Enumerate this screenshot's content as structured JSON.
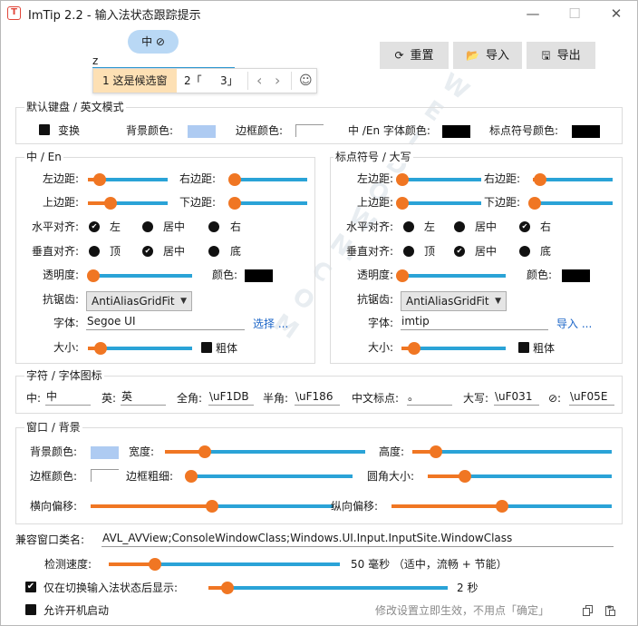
{
  "window": {
    "app_icon": "T",
    "title": "ImTip 2.2 - 输入法状态跟踪提示",
    "controls": {
      "minimize": "—",
      "maximize": "☐",
      "close": "✕"
    }
  },
  "preview": {
    "status_pill": "中 ⊘",
    "input_text": "z",
    "candidates": {
      "selected": "1 这是候选窗",
      "item2": "2「",
      "item3": "3」",
      "prev": "‹",
      "next": "›",
      "emoji": "☺"
    }
  },
  "toolbar": {
    "reset": {
      "label": "重置",
      "icon": "refresh-icon",
      "glyph": "⟳"
    },
    "import": {
      "label": "导入",
      "icon": "folder-open-icon",
      "glyph": "📂"
    },
    "export": {
      "label": "导出",
      "icon": "save-icon",
      "glyph": "🖫"
    }
  },
  "default_keyboard": {
    "title": "默认键盘 / 英文模式",
    "toggle_label": "变换",
    "toggle_checked": true,
    "bg_color_label": "背景颜色:",
    "bg_color": "#aecbf2",
    "border_color_label": "边框颜色:",
    "border_color": "#ffffff",
    "text_color_label": "中 /En 字体颜色:",
    "text_color": "#000000",
    "punct_color_label": "标点符号颜色:",
    "punct_color": "#000000"
  },
  "cn_en": {
    "title": "中 / En",
    "left_margin": "左边距:",
    "left_margin_value": 0.15,
    "right_margin": "右边距:",
    "right_margin_value": 0.05,
    "top_margin": "上边距:",
    "top_margin_value": 0.28,
    "bottom_margin": "下边距:",
    "bottom_margin_value": 0.05,
    "h_align_label": "水平对齐:",
    "h_align": [
      "左",
      "居中",
      "右"
    ],
    "h_align_selected": 0,
    "v_align_label": "垂直对齐:",
    "v_align": [
      "顶",
      "居中",
      "底"
    ],
    "v_align_selected": 1,
    "opacity_label": "透明度:",
    "opacity_value": 0.05,
    "color_label": "颜色:",
    "color": "#000000",
    "aa_label": "抗锯齿:",
    "aa_value": "AntiAliasGridFit",
    "font_label": "字体:",
    "font_value": "Segoe UI",
    "font_link": "选择 ...",
    "size_label": "大小:",
    "size_value": 0.12,
    "bold_label": "粗体",
    "bold_checked": true
  },
  "punct_caps": {
    "title": "标点符号 / 大写",
    "left_margin": "左边距:",
    "left_margin_value": 0.01,
    "right_margin": "右边距:",
    "right_margin_value": 0.09,
    "top_margin": "上边距:",
    "top_margin_value": 0.01,
    "bottom_margin": "下边距:",
    "bottom_margin_value": 0.02,
    "h_align_label": "水平对齐:",
    "h_align": [
      "左",
      "居中",
      "右"
    ],
    "h_align_selected": 2,
    "v_align_label": "垂直对齐:",
    "v_align": [
      "顶",
      "居中",
      "底"
    ],
    "v_align_selected": 1,
    "opacity_label": "透明度:",
    "opacity_value": 0.01,
    "color_label": "颜色:",
    "color": "#000000",
    "aa_label": "抗锯齿:",
    "aa_value": "AntiAliasGridFit",
    "font_label": "字体:",
    "font_value": "imtip",
    "font_link": "导入 ...",
    "size_label": "大小:",
    "size_value": 0.12,
    "bold_label": "粗体",
    "bold_checked": true
  },
  "chars": {
    "title": "字符 / 字体图标",
    "cn_label": "中:",
    "cn_value": "中",
    "en_label": "英:",
    "en_value": "英",
    "full_label": "全角:",
    "full_value": "\\uF1DB",
    "half_label": "半角:",
    "half_value": "\\uF186",
    "cnpunct_label": "中文标点:",
    "cnpunct_value": "。",
    "caps_label": "大写:",
    "caps_value": "\\uF031",
    "disabled_label": "⊘:",
    "disabled_value": "\\uF05E"
  },
  "window_bg": {
    "title": "窗口 / 背景",
    "bg_color_label": "背景颜色:",
    "bg_color": "#aecbf2",
    "width_label": "宽度:",
    "width_value": 0.2,
    "height_label": "高度:",
    "height_value": 0.12,
    "border_color_label": "边框颜色:",
    "border_color": "#ffffff",
    "border_width_label": "边框粗细:",
    "border_width_value": 0.02,
    "radius_label": "圆角大小:",
    "radius_value": 0.2,
    "hoffset_label": "横向偏移:",
    "hoffset_value": 0.5,
    "voffset_label": "纵向偏移:",
    "voffset_value": 0.5
  },
  "compat": {
    "label": "兼容窗口类名:",
    "value": "AVL_AVView;ConsoleWindowClass;Windows.UI.Input.InputSite.WindowClass"
  },
  "speed": {
    "label": "检测速度:",
    "value": 0.2,
    "readout": "50 毫秒 （适中，流畅 + 节能）"
  },
  "show_after_switch": {
    "label": "仅在切换输入法状态后显示:",
    "checked": true,
    "value": 0.08,
    "readout": "2 秒"
  },
  "autostart": {
    "label": "允许开机启动",
    "checked": true
  },
  "footer": {
    "hint": "修改设置立即生效，不用点「确定」",
    "copy_icon": "copy-icon",
    "paste_icon": "paste-icon"
  },
  "watermark": "WEIDOWN.COM"
}
